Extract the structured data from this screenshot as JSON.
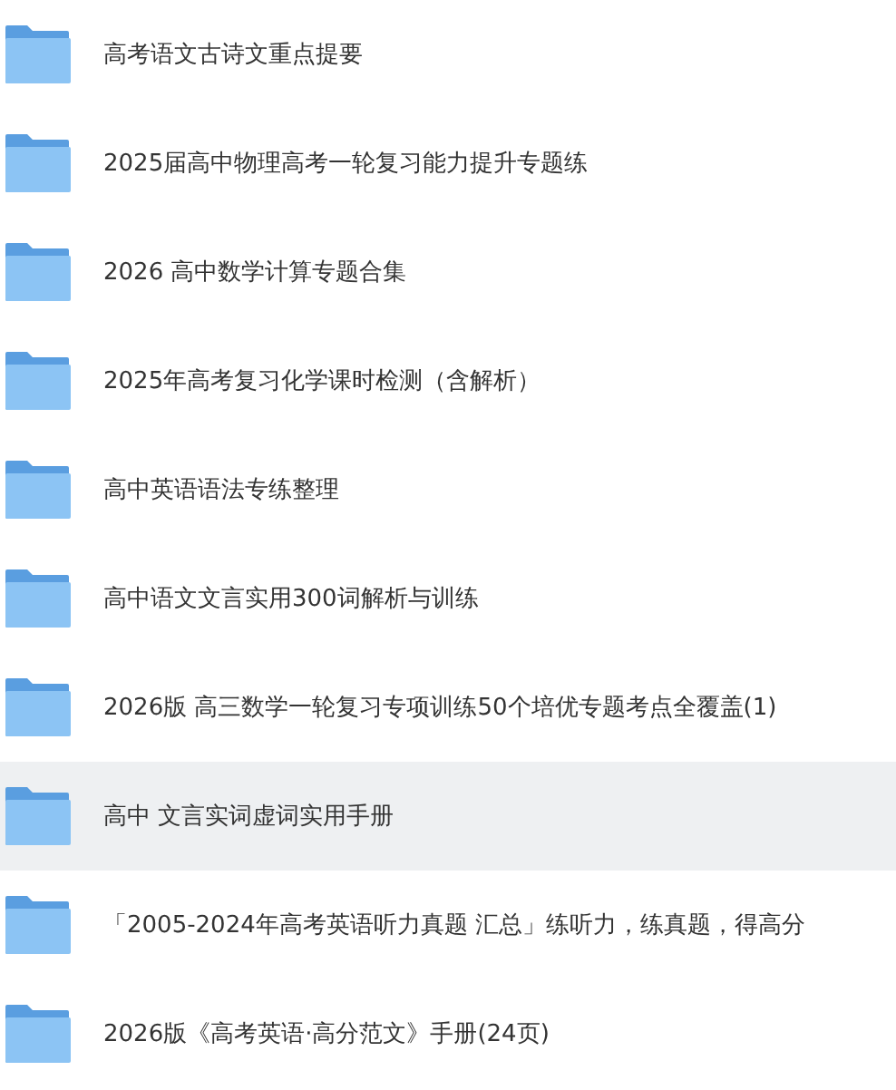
{
  "folders": [
    {
      "name": "高考语文古诗文重点提要",
      "selected": false
    },
    {
      "name": "2025届高中物理高考一轮复习能力提升专题练",
      "selected": false
    },
    {
      "name": "2026 高中数学计算专题合集",
      "selected": false
    },
    {
      "name": "2025年高考复习化学课时检测（含解析）",
      "selected": false
    },
    {
      "name": "高中英语语法专练整理",
      "selected": false
    },
    {
      "name": "高中语文文言实用300词解析与训练",
      "selected": false
    },
    {
      "name": "2026版 高三数学一轮复习专项训练50个培优专题考点全覆盖(1)",
      "selected": false
    },
    {
      "name": "高中 文言实词虚词实用手册",
      "selected": true
    },
    {
      "name": "「2005-2024年高考英语听力真题 汇总」练听力，练真题，得高分",
      "selected": false
    },
    {
      "name": "2026版《高考英语·高分范文》手册(24页)",
      "selected": false
    }
  ]
}
